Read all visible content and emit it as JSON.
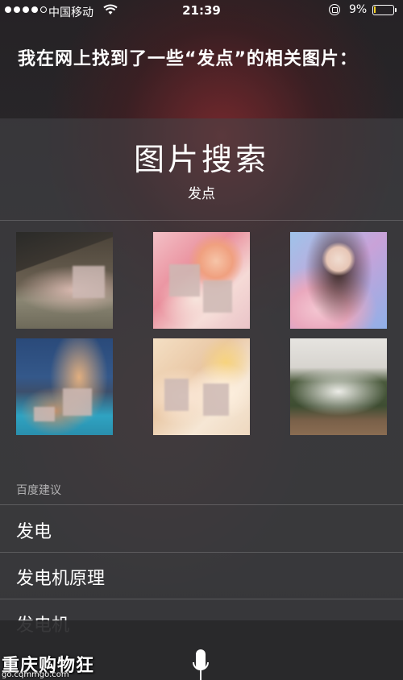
{
  "status_bar": {
    "carrier": "中国移动",
    "time": "21:39",
    "battery": "9%",
    "battery_color": "#f2d022",
    "icons": [
      "signal-dots-icon",
      "wifi-icon",
      "rotation-lock-icon",
      "battery-icon"
    ]
  },
  "siri": {
    "response": "我在网上找到了一些“发点”的相关图片："
  },
  "image_search": {
    "title": "图片搜索",
    "query": "发点",
    "thumbnails": [
      "image-result-1",
      "image-result-2",
      "image-result-3",
      "image-result-4",
      "image-result-5",
      "image-result-6"
    ]
  },
  "suggestions": {
    "header": "百度建议",
    "items": [
      "发电",
      "发电机原理",
      "发电机"
    ]
  },
  "bottom": {
    "mic_icon": "microphone-icon"
  },
  "watermark": {
    "name": "重庆购物狂",
    "url": "go.cqmmgo.com"
  }
}
